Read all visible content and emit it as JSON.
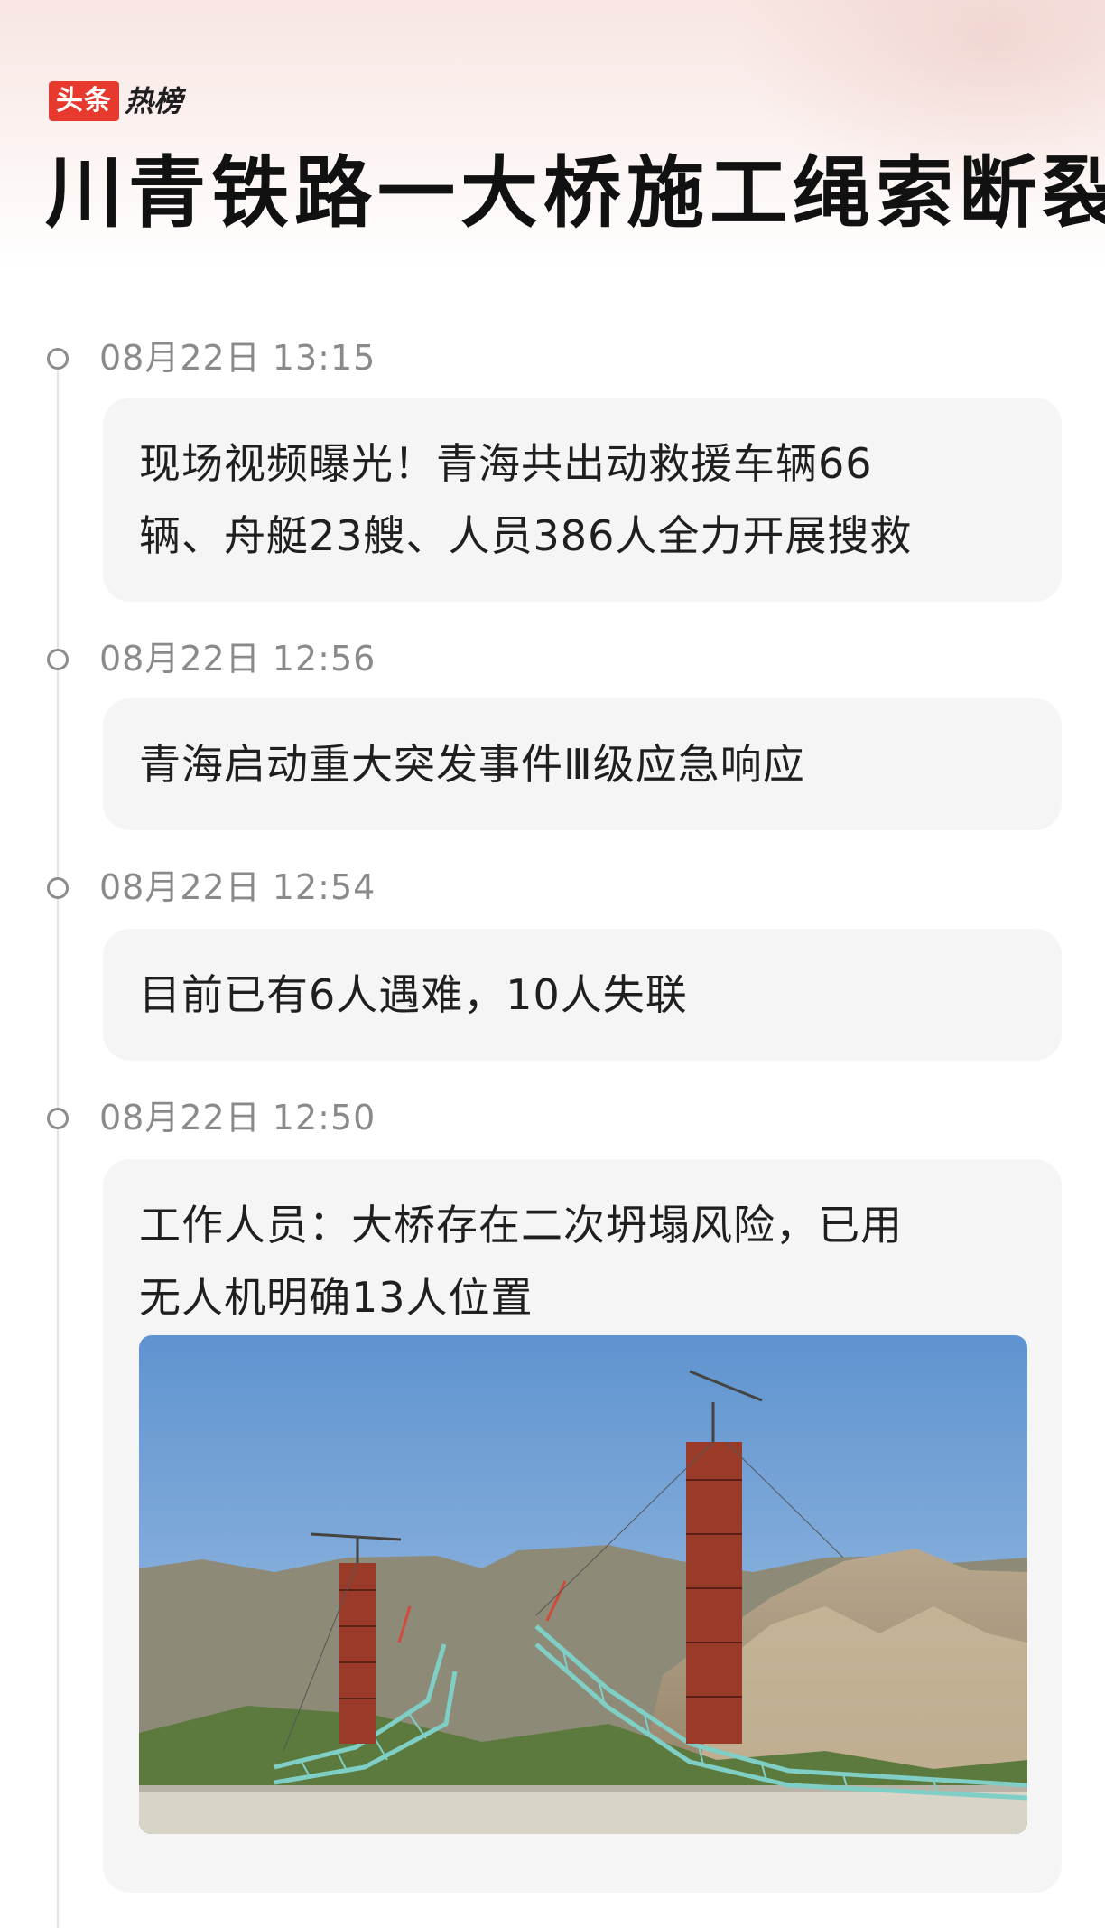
{
  "brand": {
    "toutiao": "头条",
    "rebang": "热榜"
  },
  "title": "川青铁路一大桥施工绳索断裂",
  "timeline": [
    {
      "time": "08月22日 13:15",
      "lines": [
        "现场视频曝光！青海共出动救援车辆66",
        "辆、舟艇23艘、人员386人全力开展搜救"
      ]
    },
    {
      "time": "08月22日 12:56",
      "lines": [
        "青海启动重大突发事件Ⅲ级应急响应"
      ]
    },
    {
      "time": "08月22日 12:54",
      "lines": [
        "目前已有6人遇难，10人失联"
      ]
    },
    {
      "time": "08月22日 12:50",
      "lines": [
        "工作人员：大桥存在二次坍塌风险，已用",
        "无人机明确13人位置"
      ],
      "has_photo": true
    }
  ],
  "colors": {
    "brand_red": "#e8392f",
    "card_bg": "#f5f5f5",
    "time_gray": "#8a8a8a"
  }
}
